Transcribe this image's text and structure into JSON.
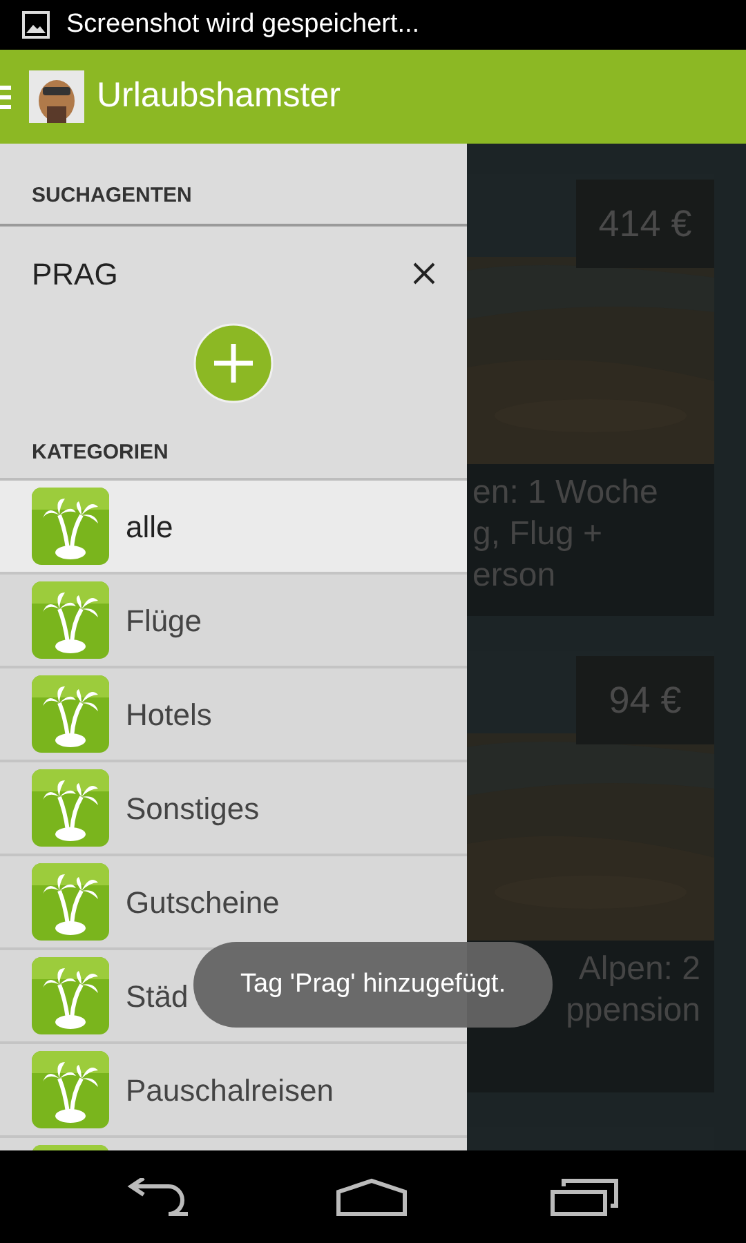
{
  "status_bar": {
    "notification": "Screenshot wird gespeichert..."
  },
  "action_bar": {
    "title": "Urlaubshamster"
  },
  "background_cards": [
    {
      "price": "414 €",
      "lines": [
        "en: 1 Woche",
        "g, Flug +",
        "erson"
      ]
    },
    {
      "price": "94 €",
      "lines": [
        "Alpen: 2",
        "ppension"
      ]
    }
  ],
  "drawer": {
    "search_agents": {
      "heading": "SUCHAGENTEN",
      "items": [
        {
          "label": "PRAG"
        }
      ]
    },
    "categories": {
      "heading": "KATEGORIEN",
      "items": [
        {
          "label": "alle",
          "selected": true
        },
        {
          "label": "Flüge",
          "selected": false
        },
        {
          "label": "Hotels",
          "selected": false
        },
        {
          "label": "Sonstiges",
          "selected": false
        },
        {
          "label": "Gutscheine",
          "selected": false
        },
        {
          "label": "Städ",
          "selected": false
        },
        {
          "label": "Pauschalreisen",
          "selected": false
        },
        {
          "selected": false
        }
      ]
    }
  },
  "toast": {
    "text": "Tag 'Prag' hinzugefügt."
  }
}
